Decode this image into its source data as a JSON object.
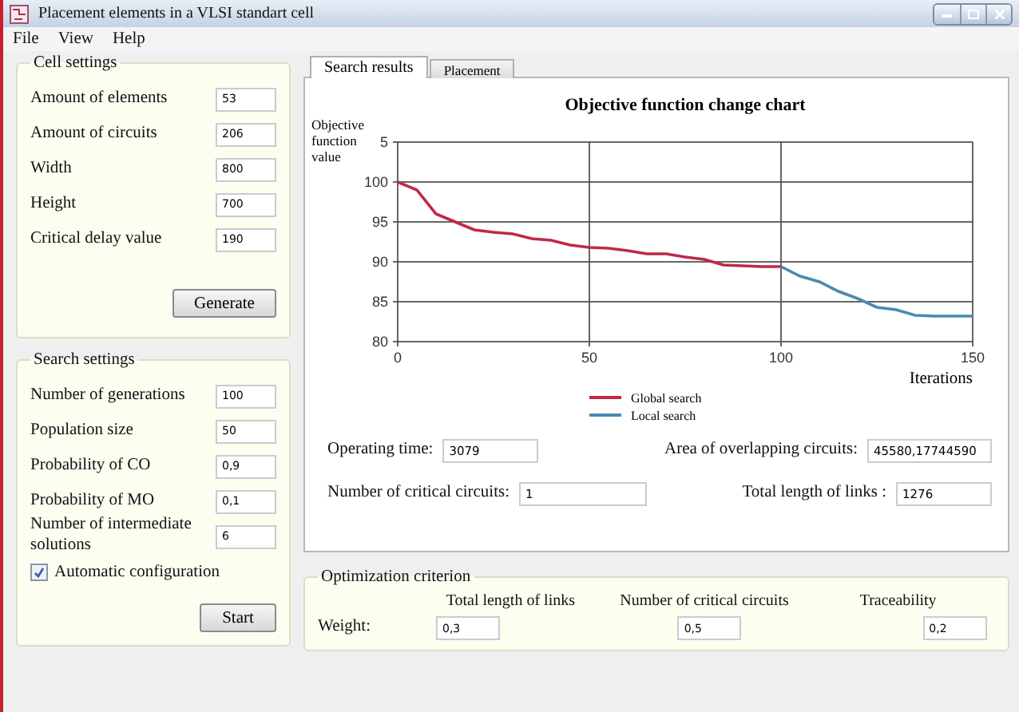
{
  "window": {
    "title": "Placement elements in a VLSI standart cell"
  },
  "menu": [
    {
      "label": "File"
    },
    {
      "label": "View"
    },
    {
      "label": "Help"
    }
  ],
  "cell_settings": {
    "title": "Cell settings",
    "fields": [
      {
        "label": "Amount of elements",
        "value": "53"
      },
      {
        "label": "Amount of circuits",
        "value": "206"
      },
      {
        "label": "Width",
        "value": "800"
      },
      {
        "label": "Height",
        "value": "700"
      },
      {
        "label": "Critical delay value",
        "value": "190"
      }
    ],
    "button": "Generate"
  },
  "search_settings": {
    "title": "Search settings",
    "fields": [
      {
        "label": "Number of generations",
        "value": "100"
      },
      {
        "label": "Population size",
        "value": "50"
      },
      {
        "label": "Probability of CO",
        "value": "0,9"
      },
      {
        "label": "Probability of MO",
        "value": "0,1"
      },
      {
        "label": "Number of intermediate solutions",
        "value": "6"
      }
    ],
    "auto_config": {
      "label": "Automatic configuration",
      "checked": true
    },
    "button": "Start"
  },
  "tabs": [
    {
      "label": "Search results",
      "selected": true
    },
    {
      "label": "Placement",
      "selected": false
    }
  ],
  "results": {
    "chart_data": {
      "type": "line",
      "title": "Objective function change chart",
      "xlabel": "Iterations",
      "ylabel": "Objective function value",
      "x": [
        0,
        5,
        10,
        15,
        20,
        25,
        30,
        35,
        40,
        45,
        50,
        55,
        60,
        65,
        70,
        75,
        80,
        85,
        90,
        95,
        100,
        105,
        110,
        115,
        120,
        125,
        130,
        135,
        140,
        145,
        150
      ],
      "series": [
        {
          "name": "Global search",
          "color": "#c0284a",
          "values": [
            100,
            99,
            96,
            95,
            94,
            93.7,
            93.5,
            92.9,
            92.7,
            92.1,
            91.8,
            91.7,
            91.4,
            91,
            91,
            90.6,
            90.3,
            89.6,
            89.5,
            89.4,
            89.4,
            null,
            null,
            null,
            null,
            null,
            null,
            null,
            null,
            null,
            null
          ]
        },
        {
          "name": "Local search",
          "color": "#4a8ab0",
          "values": [
            null,
            null,
            null,
            null,
            null,
            null,
            null,
            null,
            null,
            null,
            null,
            null,
            null,
            null,
            null,
            null,
            null,
            null,
            null,
            null,
            89.4,
            88.2,
            87.5,
            86.3,
            85.4,
            84.3,
            84,
            83.3,
            83.2,
            83.2,
            83.2
          ]
        }
      ],
      "grid": true,
      "legend": true,
      "xlim": [
        0,
        150
      ],
      "ylim": [
        80,
        105
      ],
      "xticks": [
        0,
        50,
        100,
        150
      ],
      "yticks": [
        80,
        85,
        90,
        95,
        100
      ]
    },
    "top_axis_mark": "5",
    "fields": [
      {
        "label": "Operating time:",
        "value": "3079"
      },
      {
        "label": "Area of overlapping circuits:",
        "value": "45580,17744590"
      },
      {
        "label": "Number of critical circuits:",
        "value": "1"
      },
      {
        "label": "Total length of links :",
        "value": "1276"
      }
    ]
  },
  "optimization": {
    "title": "Optimization criterion",
    "row_label": "Weight:",
    "criteria": [
      {
        "name": "Total length of links",
        "weight": "0,3"
      },
      {
        "name": "Number of critical circuits",
        "weight": "0,5"
      },
      {
        "name": "Traceability",
        "weight": "0,2"
      }
    ]
  }
}
